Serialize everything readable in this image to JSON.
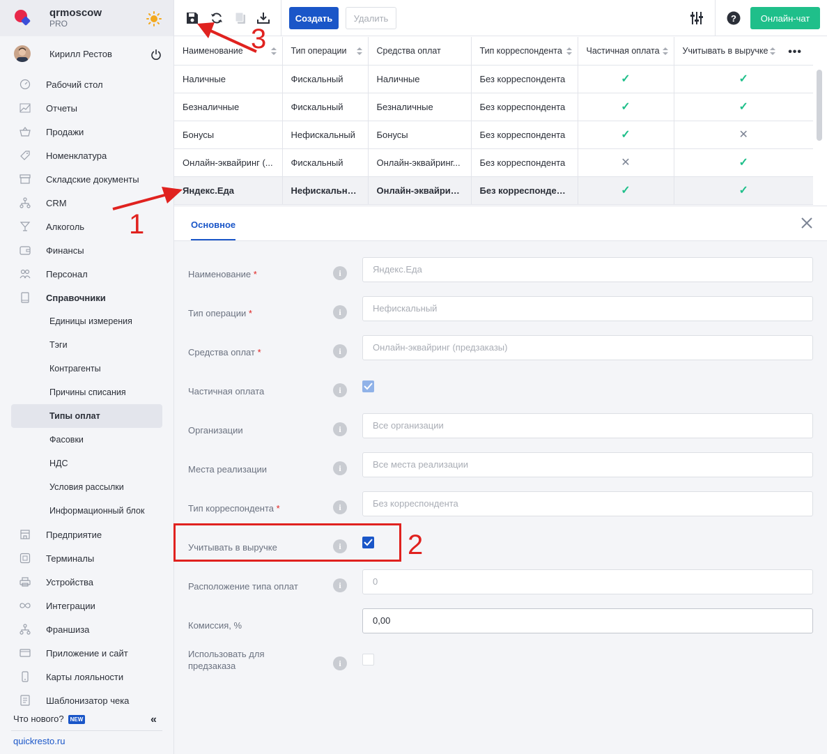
{
  "brand": {
    "name": "qrmoscow",
    "plan": "PRO"
  },
  "user": {
    "name": "Кирилл Рестов"
  },
  "nav": {
    "items": [
      {
        "label": "Рабочий стол",
        "icon": "dashboard-icon"
      },
      {
        "label": "Отчеты",
        "icon": "reports-icon"
      },
      {
        "label": "Продажи",
        "icon": "basket-icon"
      },
      {
        "label": "Номенклатура",
        "icon": "tag-icon"
      },
      {
        "label": "Складские документы",
        "icon": "archive-icon"
      },
      {
        "label": "CRM",
        "icon": "crm-icon"
      },
      {
        "label": "Алкоголь",
        "icon": "glass-icon"
      },
      {
        "label": "Финансы",
        "icon": "wallet-icon"
      },
      {
        "label": "Персонал",
        "icon": "people-icon"
      },
      {
        "label": "Справочники",
        "icon": "book-icon"
      }
    ],
    "sub_items": [
      "Единицы измерения",
      "Тэги",
      "Контрагенты",
      "Причины списания",
      "Типы оплат",
      "Фасовки",
      "НДС",
      "Условия рассылки",
      "Информационный блок"
    ],
    "active_sub": "Типы оплат",
    "items_after": [
      {
        "label": "Предприятие",
        "icon": "store-icon"
      },
      {
        "label": "Терминалы",
        "icon": "qr-icon"
      },
      {
        "label": "Устройства",
        "icon": "printer-icon"
      },
      {
        "label": "Интеграции",
        "icon": "infinity-icon"
      },
      {
        "label": "Франшиза",
        "icon": "hierarchy-icon"
      },
      {
        "label": "Приложение и сайт",
        "icon": "app-icon"
      },
      {
        "label": "Карты лояльности",
        "icon": "card-icon"
      },
      {
        "label": "Шаблонизатор чека",
        "icon": "receipt-icon"
      }
    ],
    "whats_new": "Что нового?",
    "new_badge": "NEW",
    "collapse": "«",
    "site": "quickresto.ru"
  },
  "toolbar": {
    "create": "Создать",
    "delete": "Удалить",
    "chat": "Онлайн-чат"
  },
  "table": {
    "columns": [
      "Наименование",
      "Тип операции",
      "Средства оплат",
      "Тип корреспондента",
      "Частичная оплата",
      "Учитывать в выручке"
    ],
    "rows": [
      {
        "name": "Наличные",
        "op": "Фискальный",
        "means": "Наличные",
        "corr": "Без корреспондента",
        "partial": true,
        "revenue": true
      },
      {
        "name": "Безналичные",
        "op": "Фискальный",
        "means": "Безналичные",
        "corr": "Без корреспондента",
        "partial": true,
        "revenue": true
      },
      {
        "name": "Бонусы",
        "op": "Нефискальный",
        "means": "Бонусы",
        "corr": "Без корреспондента",
        "partial": true,
        "revenue": false
      },
      {
        "name": "Онлайн-эквайринг (...",
        "op": "Фискальный",
        "means": "Онлайн-эквайринг...",
        "corr": "Без корреспондента",
        "partial": false,
        "revenue": true
      },
      {
        "name": "Яндекс.Еда",
        "op": "Нефискальный",
        "means": "Онлайн-эквайрин...",
        "corr": "Без корреспондента",
        "partial": true,
        "revenue": true
      }
    ],
    "selected_row": 4
  },
  "form": {
    "tab": "Основное",
    "fields": {
      "name": {
        "label": "Наименование",
        "value": "Яндекс.Еда"
      },
      "op_type": {
        "label": "Тип операции",
        "value": "Нефискальный"
      },
      "means": {
        "label": "Средства оплат",
        "value": "Онлайн-эквайринг (предзаказы)"
      },
      "partial": {
        "label": "Частичная оплата",
        "checked": true
      },
      "orgs": {
        "label": "Организации",
        "value": "Все организации"
      },
      "places": {
        "label": "Места реализации",
        "value": "Все места реализации"
      },
      "corr": {
        "label": "Тип корреспондента",
        "value": "Без корреспондента"
      },
      "revenue": {
        "label": "Учитывать в выручке",
        "checked": true
      },
      "position": {
        "label": "Расположение типа оплат",
        "value": "0"
      },
      "commission": {
        "label": "Комиссия, %",
        "value": "0,00"
      },
      "preorder": {
        "label": "Использовать для предзаказа",
        "checked": false
      }
    },
    "required_mark": "*",
    "info_glyph": "i"
  },
  "annotations": {
    "n1": "1",
    "n2": "2",
    "n3": "3"
  },
  "colors": {
    "primary": "#1a56c8",
    "success": "#1fbf8a",
    "annotation": "#e0221f"
  }
}
